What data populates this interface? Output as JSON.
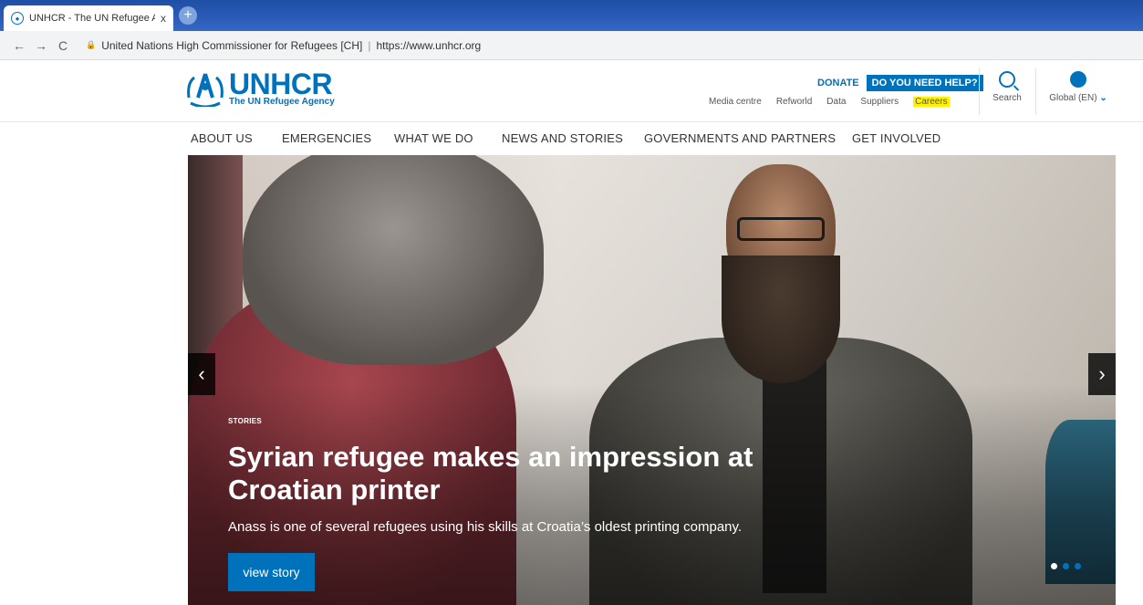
{
  "browser": {
    "tab_title": "UNHCR - The UN Refugee Agen",
    "tab_close": "x",
    "new_tab": "+",
    "back": "←",
    "forward": "→",
    "reload": "C",
    "site_identity": "United Nations High Commissioner for Refugees [CH]",
    "url_separator": "|",
    "url": "https://www.unhcr.org"
  },
  "header": {
    "brand": "UNHCR",
    "tagline": "The UN Refugee Agency",
    "donate": "DONATE",
    "help": "DO YOU NEED HELP?",
    "util_links": [
      "Media centre",
      "Refworld",
      "Data",
      "Suppliers",
      "Careers"
    ],
    "search_label": "Search",
    "global_label": "Global (EN)",
    "global_chevron": "⌄"
  },
  "main_nav": [
    "ABOUT US",
    "EMERGENCIES",
    "WHAT WE DO",
    "NEWS AND STORIES",
    "GOVERNMENTS AND PARTNERS",
    "GET INVOLVED"
  ],
  "hero": {
    "category": "STORIES",
    "headline": "Syrian refugee makes an impression at Croatian printer",
    "summary": "Anass is one of several refugees using his skills at Croatia’s oldest printing company.",
    "cta": "view story",
    "prev": "‹",
    "next": "›",
    "slide_count": 3,
    "active_slide": 1
  },
  "colors": {
    "brand_blue": "#0072bc",
    "highlight": "#fff200",
    "tabbar": "#2a5cb8"
  }
}
